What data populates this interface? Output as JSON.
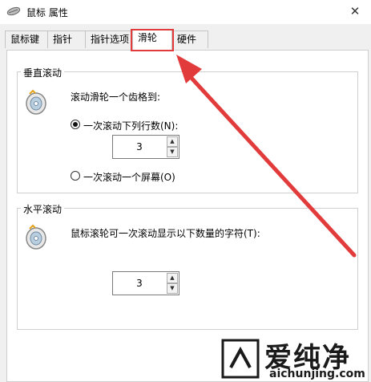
{
  "window": {
    "title": "鼠标 属性"
  },
  "tabs": [
    {
      "label": "鼠标键"
    },
    {
      "label": "指针"
    },
    {
      "label": "指针选项"
    },
    {
      "label": "滑轮"
    },
    {
      "label": "硬件"
    }
  ],
  "active_tab": "滑轮",
  "vertical_scroll": {
    "group_title": "垂直滚动",
    "description": "滚动滑轮一个齿格到:",
    "option_lines": "一次滚动下列行数(N):",
    "option_lines_selected": true,
    "lines_value": "3",
    "option_screen": "一次滚动一个屏幕(O)"
  },
  "horizontal_scroll": {
    "group_title": "水平滚动",
    "description": "鼠标滚轮可一次滚动显示以下数量的字符(T):",
    "chars_value": "3"
  },
  "watermark": {
    "text": "爱纯净",
    "url": "aichunjing.com"
  },
  "colors": {
    "highlight": "#e23b3b",
    "arrow": "#e23b3b"
  },
  "icons": [
    "mouse-icon",
    "close-icon",
    "mouse-wheel-icon",
    "spin-up-icon",
    "spin-down-icon",
    "logo-icon"
  ]
}
